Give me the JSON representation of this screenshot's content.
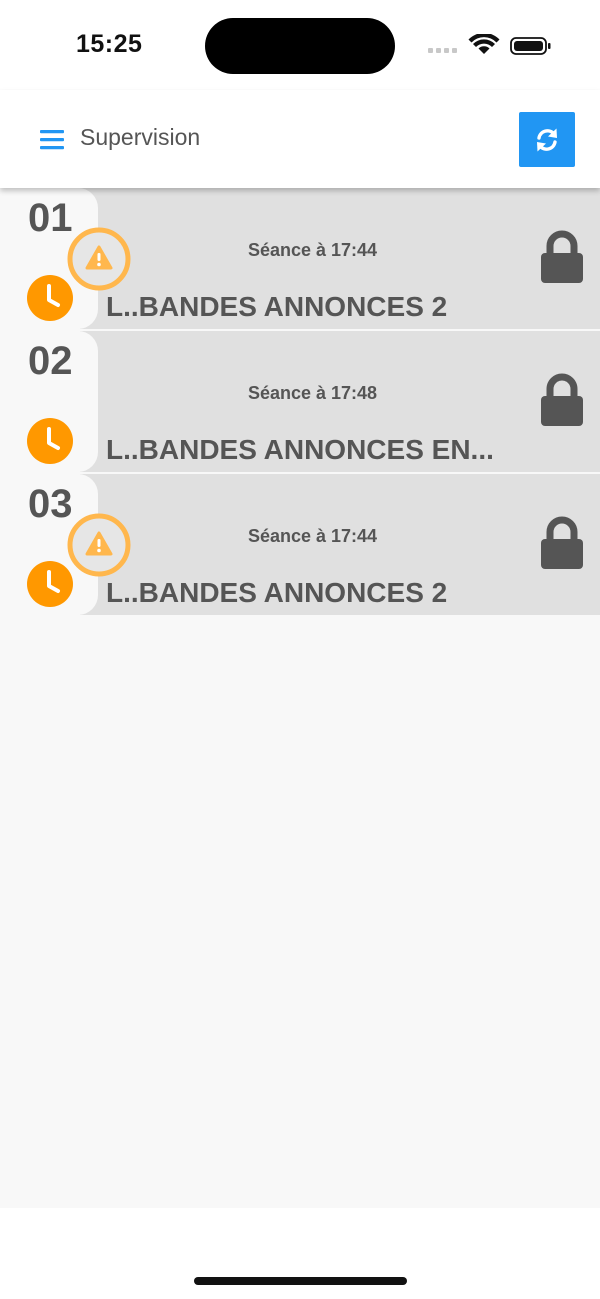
{
  "status_bar": {
    "time": "15:25",
    "icons": [
      "cellular-signal-icon",
      "wifi-icon",
      "battery-icon"
    ]
  },
  "header": {
    "title": "Supervision",
    "menu_icon": "hamburger-menu-icon",
    "refresh_icon": "refresh-icon"
  },
  "rows": [
    {
      "number": "01",
      "session": "Séance à 17:44",
      "title": "L..BANDES ANNONCES 2",
      "has_warning": true,
      "locked": true
    },
    {
      "number": "02",
      "session": "Séance à 17:48",
      "title": "L..BANDES ANNONCES EN...",
      "has_warning": false,
      "locked": true
    },
    {
      "number": "03",
      "session": "Séance à 17:44",
      "title": "L..BANDES ANNONCES 2",
      "has_warning": true,
      "locked": true
    }
  ],
  "colors": {
    "accent": "#2196f3",
    "clock_orange": "#ff9800",
    "warning_orange": "#ffb74d",
    "card_gray": "#e0e0e0",
    "text_gray": "#555555"
  }
}
